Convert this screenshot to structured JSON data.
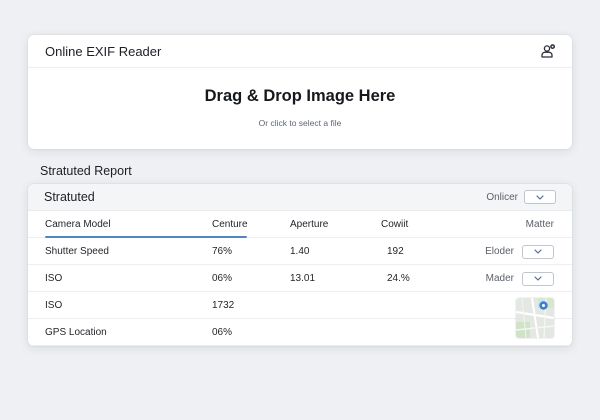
{
  "app": {
    "title": "Online EXIF Reader",
    "user_icon": "user-gear-icon"
  },
  "dropzone": {
    "title": "Drag & Drop Image Here",
    "subtitle": "Or click to select a file"
  },
  "report": {
    "heading": "Stratuted Report",
    "panel_title": "Stratuted",
    "header_select_label": "Onlicer",
    "columns": [
      "Camera Model",
      "Centure",
      "Aperture",
      "Cowiit",
      "Matter"
    ],
    "rows": [
      {
        "label": "Shutter Speed",
        "v1": "76%",
        "v2": "1.40",
        "v3": "192",
        "end_label": "Eloder"
      },
      {
        "label": "ISO",
        "v1": "06%",
        "v2": "13.01",
        "v3": "24.%",
        "end_label": "Mader"
      },
      {
        "label": "ISO",
        "v1": "1732",
        "v2": "",
        "v3": "",
        "end_label": ""
      },
      {
        "label": "GPS Location",
        "v1": "06%",
        "v2": "",
        "v3": "",
        "end_label": ""
      }
    ],
    "map_icon": "map-pin-icon"
  },
  "colors": {
    "accent": "#4e86c4",
    "background": "#eef0f3",
    "card": "#ffffff",
    "header_band": "#f4f5f7"
  }
}
